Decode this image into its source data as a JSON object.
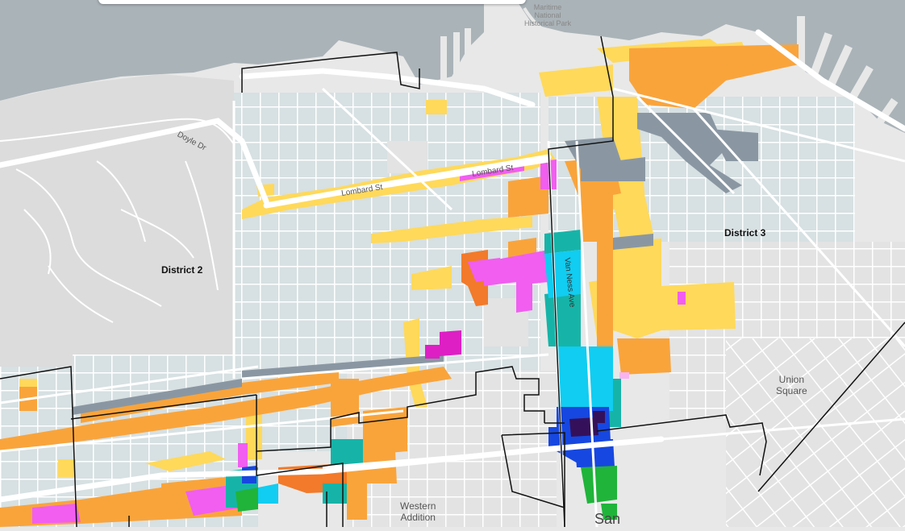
{
  "map": {
    "search_box": {
      "placeholder": ""
    },
    "district_labels": [
      "District 2",
      "District 3"
    ],
    "street_labels": [
      "Lombard St",
      "Lombard St",
      "Doyle Dr",
      "Van Ness Ave"
    ],
    "area_labels": {
      "union_square": [
        "Union",
        "Square"
      ],
      "western_addition": [
        "Western",
        "Addition"
      ],
      "park": [
        "Maritime",
        "National",
        "Historical Park"
      ],
      "city_partial": "San"
    },
    "colors": {
      "water": "#aab3b8",
      "land": "#e8e8e8",
      "presidio": "#dcdcdc",
      "base_zone": "#d7e0e2",
      "yellow": "#ffd95a",
      "light_yellow": "#fbe56d",
      "orange": "#f9a43b",
      "dark_orange": "#f27a2a",
      "magenta": "#f15ef0",
      "deep_magenta": "#dd1fc4",
      "cyan": "#10cdf1",
      "teal": "#16b4a8",
      "blue": "#1647e0",
      "dark_purple": "#35105a",
      "green": "#20b43a",
      "gray_blue": "#8a97a3",
      "district_line": "#111111",
      "road": "#ffffff"
    }
  }
}
